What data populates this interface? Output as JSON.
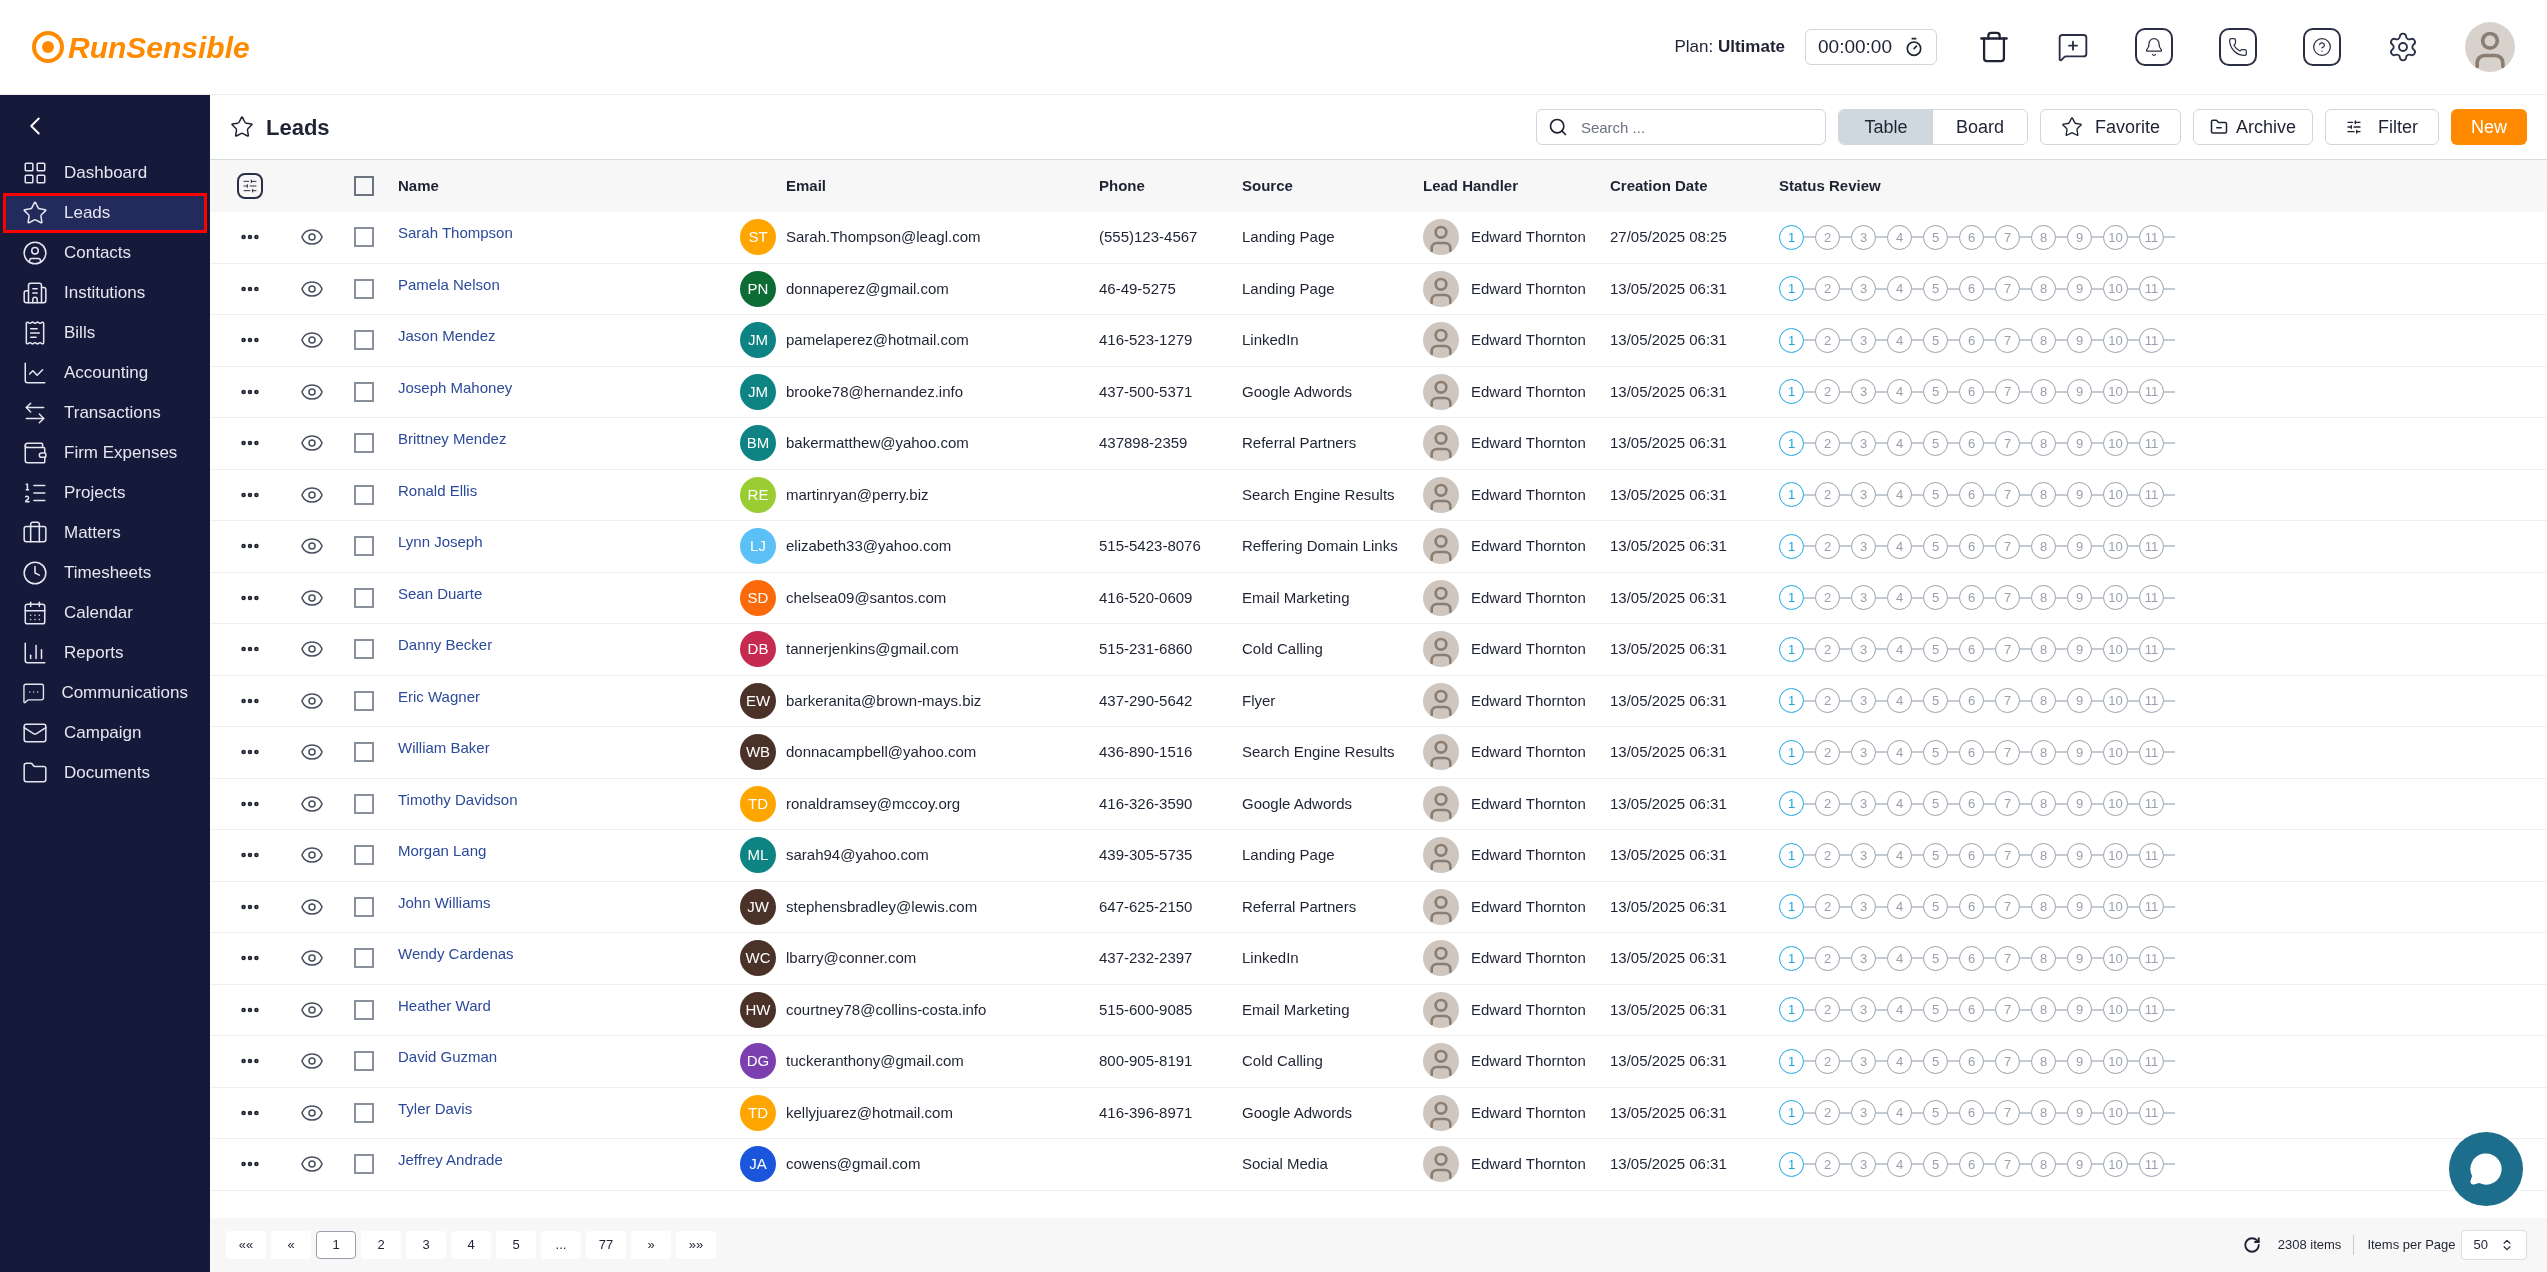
{
  "header": {
    "logo": "RunSensible",
    "plan": "Plan: **Ultimate**",
    "timer": "00:00:00"
  },
  "sidebar": {
    "items": [
      {
        "label": "Dashboard",
        "selected": false
      },
      {
        "label": "Leads",
        "selected": true
      },
      {
        "label": "Contacts",
        "selected": false
      },
      {
        "label": "Institutions",
        "selected": false
      },
      {
        "label": "Bills",
        "selected": false
      },
      {
        "label": "Accounting",
        "selected": false
      },
      {
        "label": "Transactions",
        "selected": false
      },
      {
        "label": "Firm Expenses",
        "selected": false
      },
      {
        "label": "Projects",
        "selected": false
      },
      {
        "label": "Matters",
        "selected": false
      },
      {
        "label": "Timesheets",
        "selected": false
      },
      {
        "label": "Calendar",
        "selected": false
      },
      {
        "label": "Reports",
        "selected": false
      },
      {
        "label": "Communications",
        "selected": false
      },
      {
        "label": "Campaign",
        "selected": false
      },
      {
        "label": "Documents",
        "selected": false
      }
    ]
  },
  "page": {
    "title": "Leads",
    "search": {
      "placeholder": "Search ..."
    },
    "views": [
      {
        "label": "Table",
        "selected": true
      },
      {
        "label": "Board",
        "selected": false
      }
    ],
    "buttons": {
      "favorite": "Favorite",
      "archive": "Archive",
      "filter": "Filter",
      "new": "New"
    }
  },
  "table": {
    "columns": [
      "Name",
      "Email",
      "Phone",
      "Source",
      "Lead Handler",
      "Creation Date",
      "Status Review"
    ],
    "select_all": {
      "checked": false
    },
    "rows": [
      {
        "checked": false,
        "name": "Sarah Thompson",
        "initials": "ST",
        "color": "#ffa500",
        "email": "Sarah.Thompson@leagl.com",
        "phone": "(555)123-4567",
        "source": "Landing Page",
        "handler": "Edward Thornton",
        "date": "27/05/2025 08:25",
        "status": [
          {
            "label": "1",
            "selected": true
          },
          {
            "label": "2",
            "selected": false
          },
          {
            "label": "3",
            "selected": false
          },
          {
            "label": "4",
            "selected": false
          },
          {
            "label": "5",
            "selected": false
          },
          {
            "label": "6",
            "selected": false
          },
          {
            "label": "7",
            "selected": false
          },
          {
            "label": "8",
            "selected": false
          },
          {
            "label": "9",
            "selected": false
          },
          {
            "label": "10",
            "selected": false
          },
          {
            "label": "11",
            "selected": false
          }
        ]
      },
      {
        "checked": false,
        "name": "Pamela Nelson",
        "initials": "PN",
        "color": "#0d6b34",
        "email": "donnaperez@gmail.com",
        "phone": "46-49-5275",
        "source": "Landing Page",
        "handler": "Edward Thornton",
        "date": "13/05/2025 06:31",
        "status": [
          {
            "label": "1",
            "selected": true
          },
          {
            "label": "2",
            "selected": false
          },
          {
            "label": "3",
            "selected": false
          },
          {
            "label": "4",
            "selected": false
          },
          {
            "label": "5",
            "selected": false
          },
          {
            "label": "6",
            "selected": false
          },
          {
            "label": "7",
            "selected": false
          },
          {
            "label": "8",
            "selected": false
          },
          {
            "label": "9",
            "selected": false
          },
          {
            "label": "10",
            "selected": false
          },
          {
            "label": "11",
            "selected": false
          }
        ]
      },
      {
        "checked": false,
        "name": "Jason Mendez",
        "initials": "JM",
        "color": "#0e8383",
        "email": "pamelaperez@hotmail.com",
        "phone": "416-523-1279",
        "source": "LinkedIn",
        "handler": "Edward Thornton",
        "date": "13/05/2025 06:31",
        "status": [
          {
            "label": "1",
            "selected": true
          },
          {
            "label": "2",
            "selected": false
          },
          {
            "label": "3",
            "selected": false
          },
          {
            "label": "4",
            "selected": false
          },
          {
            "label": "5",
            "selected": false
          },
          {
            "label": "6",
            "selected": false
          },
          {
            "label": "7",
            "selected": false
          },
          {
            "label": "8",
            "selected": false
          },
          {
            "label": "9",
            "selected": false
          },
          {
            "label": "10",
            "selected": false
          },
          {
            "label": "11",
            "selected": false
          }
        ]
      },
      {
        "checked": false,
        "name": "Joseph Mahoney",
        "initials": "JM",
        "color": "#0e8383",
        "email": "brooke78@hernandez.info",
        "phone": "437-500-5371",
        "source": "Google Adwords",
        "handler": "Edward Thornton",
        "date": "13/05/2025 06:31",
        "status": [
          {
            "label": "1",
            "selected": true
          },
          {
            "label": "2",
            "selected": false
          },
          {
            "label": "3",
            "selected": false
          },
          {
            "label": "4",
            "selected": false
          },
          {
            "label": "5",
            "selected": false
          },
          {
            "label": "6",
            "selected": false
          },
          {
            "label": "7",
            "selected": false
          },
          {
            "label": "8",
            "selected": false
          },
          {
            "label": "9",
            "selected": false
          },
          {
            "label": "10",
            "selected": false
          },
          {
            "label": "11",
            "selected": false
          }
        ]
      },
      {
        "checked": false,
        "name": "Brittney Mendez",
        "initials": "BM",
        "color": "#0e8383",
        "email": "bakermatthew@yahoo.com",
        "phone": "437898-2359",
        "source": "Referral Partners",
        "handler": "Edward Thornton",
        "date": "13/05/2025 06:31",
        "status": [
          {
            "label": "1",
            "selected": true
          },
          {
            "label": "2",
            "selected": false
          },
          {
            "label": "3",
            "selected": false
          },
          {
            "label": "4",
            "selected": false
          },
          {
            "label": "5",
            "selected": false
          },
          {
            "label": "6",
            "selected": false
          },
          {
            "label": "7",
            "selected": false
          },
          {
            "label": "8",
            "selected": false
          },
          {
            "label": "9",
            "selected": false
          },
          {
            "label": "10",
            "selected": false
          },
          {
            "label": "11",
            "selected": false
          }
        ]
      },
      {
        "checked": false,
        "name": "Ronald Ellis",
        "initials": "RE",
        "color": "#9acd32",
        "email": "martinryan@perry.biz",
        "source": "Search Engine Results",
        "handler": "Edward Thornton",
        "date": "13/05/2025 06:31",
        "status": [
          {
            "label": "1",
            "selected": true
          },
          {
            "label": "2",
            "selected": false
          },
          {
            "label": "3",
            "selected": false
          },
          {
            "label": "4",
            "selected": false
          },
          {
            "label": "5",
            "selected": false
          },
          {
            "label": "6",
            "selected": false
          },
          {
            "label": "7",
            "selected": false
          },
          {
            "label": "8",
            "selected": false
          },
          {
            "label": "9",
            "selected": false
          },
          {
            "label": "10",
            "selected": false
          },
          {
            "label": "11",
            "selected": false
          }
        ]
      },
      {
        "checked": false,
        "name": "Lynn Joseph",
        "initials": "LJ",
        "color": "#5bc0f5",
        "email": "elizabeth33@yahoo.com",
        "phone": "515-5423-8076",
        "source": "Reffering Domain Links",
        "handler": "Edward Thornton",
        "date": "13/05/2025 06:31",
        "status": [
          {
            "label": "1",
            "selected": true
          },
          {
            "label": "2",
            "selected": false
          },
          {
            "label": "3",
            "selected": false
          },
          {
            "label": "4",
            "selected": false
          },
          {
            "label": "5",
            "selected": false
          },
          {
            "label": "6",
            "selected": false
          },
          {
            "label": "7",
            "selected": false
          },
          {
            "label": "8",
            "selected": false
          },
          {
            "label": "9",
            "selected": false
          },
          {
            "label": "10",
            "selected": false
          },
          {
            "label": "11",
            "selected": false
          }
        ]
      },
      {
        "checked": false,
        "name": "Sean Duarte",
        "initials": "SD",
        "color": "#fa6a0a",
        "email": "chelsea09@santos.com",
        "phone": "416-520-0609",
        "source": "Email Marketing",
        "handler": "Edward Thornton",
        "date": "13/05/2025 06:31",
        "status": [
          {
            "label": "1",
            "selected": true
          },
          {
            "label": "2",
            "selected": false
          },
          {
            "label": "3",
            "selected": false
          },
          {
            "label": "4",
            "selected": false
          },
          {
            "label": "5",
            "selected": false
          },
          {
            "label": "6",
            "selected": false
          },
          {
            "label": "7",
            "selected": false
          },
          {
            "label": "8",
            "selected": false
          },
          {
            "label": "9",
            "selected": false
          },
          {
            "label": "10",
            "selected": false
          },
          {
            "label": "11",
            "selected": false
          }
        ]
      },
      {
        "checked": false,
        "name": "Danny Becker",
        "initials": "DB",
        "color": "#c62a50",
        "email": "tannerjenkins@gmail.com",
        "phone": "515-231-6860",
        "source": "Cold Calling",
        "handler": "Edward Thornton",
        "date": "13/05/2025 06:31",
        "status": [
          {
            "label": "1",
            "selected": true
          },
          {
            "label": "2",
            "selected": false
          },
          {
            "label": "3",
            "selected": false
          },
          {
            "label": "4",
            "selected": false
          },
          {
            "label": "5",
            "selected": false
          },
          {
            "label": "6",
            "selected": false
          },
          {
            "label": "7",
            "selected": false
          },
          {
            "label": "8",
            "selected": false
          },
          {
            "label": "9",
            "selected": false
          },
          {
            "label": "10",
            "selected": false
          },
          {
            "label": "11",
            "selected": false
          }
        ]
      },
      {
        "checked": false,
        "name": "Eric Wagner",
        "initials": "EW",
        "color": "#4a3228",
        "email": "barkeranita@brown-mays.biz",
        "phone": "437-290-5642",
        "source": "Flyer",
        "handler": "Edward Thornton",
        "date": "13/05/2025 06:31",
        "status": [
          {
            "label": "1",
            "selected": true
          },
          {
            "label": "2",
            "selected": false
          },
          {
            "label": "3",
            "selected": false
          },
          {
            "label": "4",
            "selected": false
          },
          {
            "label": "5",
            "selected": false
          },
          {
            "label": "6",
            "selected": false
          },
          {
            "label": "7",
            "selected": false
          },
          {
            "label": "8",
            "selected": false
          },
          {
            "label": "9",
            "selected": false
          },
          {
            "label": "10",
            "selected": false
          },
          {
            "label": "11",
            "selected": false
          }
        ]
      },
      {
        "checked": false,
        "name": "William Baker",
        "initials": "WB",
        "color": "#4a3228",
        "email": "donnacampbell@yahoo.com",
        "phone": "436-890-1516",
        "source": "Search Engine Results",
        "handler": "Edward Thornton",
        "date": "13/05/2025 06:31",
        "status": [
          {
            "label": "1",
            "selected": true
          },
          {
            "label": "2",
            "selected": false
          },
          {
            "label": "3",
            "selected": false
          },
          {
            "label": "4",
            "selected": false
          },
          {
            "label": "5",
            "selected": false
          },
          {
            "label": "6",
            "selected": false
          },
          {
            "label": "7",
            "selected": false
          },
          {
            "label": "8",
            "selected": false
          },
          {
            "label": "9",
            "selected": false
          },
          {
            "label": "10",
            "selected": false
          },
          {
            "label": "11",
            "selected": false
          }
        ]
      },
      {
        "checked": false,
        "name": "Timothy Davidson",
        "initials": "TD",
        "color": "#ffa500",
        "email": "ronaldramsey@mccoy.org",
        "phone": "416-326-3590",
        "source": "Google Adwords",
        "handler": "Edward Thornton",
        "date": "13/05/2025 06:31",
        "status": [
          {
            "label": "1",
            "selected": true
          },
          {
            "label": "2",
            "selected": false
          },
          {
            "label": "3",
            "selected": false
          },
          {
            "label": "4",
            "selected": false
          },
          {
            "label": "5",
            "selected": false
          },
          {
            "label": "6",
            "selected": false
          },
          {
            "label": "7",
            "selected": false
          },
          {
            "label": "8",
            "selected": false
          },
          {
            "label": "9",
            "selected": false
          },
          {
            "label": "10",
            "selected": false
          },
          {
            "label": "11",
            "selected": false
          }
        ]
      },
      {
        "checked": false,
        "name": "Morgan Lang",
        "initials": "ML",
        "color": "#0e8383",
        "email": "sarah94@yahoo.com",
        "phone": "439-305-5735",
        "source": "Landing Page",
        "handler": "Edward Thornton",
        "date": "13/05/2025 06:31",
        "status": [
          {
            "label": "1",
            "selected": true
          },
          {
            "label": "2",
            "selected": false
          },
          {
            "label": "3",
            "selected": false
          },
          {
            "label": "4",
            "selected": false
          },
          {
            "label": "5",
            "selected": false
          },
          {
            "label": "6",
            "selected": false
          },
          {
            "label": "7",
            "selected": false
          },
          {
            "label": "8",
            "selected": false
          },
          {
            "label": "9",
            "selected": false
          },
          {
            "label": "10",
            "selected": false
          },
          {
            "label": "11",
            "selected": false
          }
        ]
      },
      {
        "checked": false,
        "name": "John Williams",
        "initials": "JW",
        "color": "#4a3228",
        "email": "stephensbradley@lewis.com",
        "phone": "647-625-2150",
        "source": "Referral Partners",
        "handler": "Edward Thornton",
        "date": "13/05/2025 06:31",
        "status": [
          {
            "label": "1",
            "selected": true
          },
          {
            "label": "2",
            "selected": false
          },
          {
            "label": "3",
            "selected": false
          },
          {
            "label": "4",
            "selected": false
          },
          {
            "label": "5",
            "selected": false
          },
          {
            "label": "6",
            "selected": false
          },
          {
            "label": "7",
            "selected": false
          },
          {
            "label": "8",
            "selected": false
          },
          {
            "label": "9",
            "selected": false
          },
          {
            "label": "10",
            "selected": false
          },
          {
            "label": "11",
            "selected": false
          }
        ]
      },
      {
        "checked": false,
        "name": "Wendy Cardenas",
        "initials": "WC",
        "color": "#4a3228",
        "email": "lbarry@conner.com",
        "phone": "437-232-2397",
        "source": "LinkedIn",
        "handler": "Edward Thornton",
        "date": "13/05/2025 06:31",
        "status": [
          {
            "label": "1",
            "selected": true
          },
          {
            "label": "2",
            "selected": false
          },
          {
            "label": "3",
            "selected": false
          },
          {
            "label": "4",
            "selected": false
          },
          {
            "label": "5",
            "selected": false
          },
          {
            "label": "6",
            "selected": false
          },
          {
            "label": "7",
            "selected": false
          },
          {
            "label": "8",
            "selected": false
          },
          {
            "label": "9",
            "selected": false
          },
          {
            "label": "10",
            "selected": false
          },
          {
            "label": "11",
            "selected": false
          }
        ]
      },
      {
        "checked": false,
        "name": "Heather Ward",
        "initials": "HW",
        "color": "#4a3228",
        "email": "courtney78@collins-costa.info",
        "phone": "515-600-9085",
        "source": "Email Marketing",
        "handler": "Edward Thornton",
        "date": "13/05/2025 06:31",
        "status": [
          {
            "label": "1",
            "selected": true
          },
          {
            "label": "2",
            "selected": false
          },
          {
            "label": "3",
            "selected": false
          },
          {
            "label": "4",
            "selected": false
          },
          {
            "label": "5",
            "selected": false
          },
          {
            "label": "6",
            "selected": false
          },
          {
            "label": "7",
            "selected": false
          },
          {
            "label": "8",
            "selected": false
          },
          {
            "label": "9",
            "selected": false
          },
          {
            "label": "10",
            "selected": false
          },
          {
            "label": "11",
            "selected": false
          }
        ]
      },
      {
        "checked": false,
        "name": "David Guzman",
        "initials": "DG",
        "color": "#7b3fb0",
        "email": "tuckeranthony@gmail.com",
        "phone": "800-905-8191",
        "source": "Cold Calling",
        "handler": "Edward Thornton",
        "date": "13/05/2025 06:31",
        "status": [
          {
            "label": "1",
            "selected": true
          },
          {
            "label": "2",
            "selected": false
          },
          {
            "label": "3",
            "selected": false
          },
          {
            "label": "4",
            "selected": false
          },
          {
            "label": "5",
            "selected": false
          },
          {
            "label": "6",
            "selected": false
          },
          {
            "label": "7",
            "selected": false
          },
          {
            "label": "8",
            "selected": false
          },
          {
            "label": "9",
            "selected": false
          },
          {
            "label": "10",
            "selected": false
          },
          {
            "label": "11",
            "selected": false
          }
        ]
      },
      {
        "checked": false,
        "name": "Tyler Davis",
        "initials": "TD",
        "color": "#ffa500",
        "email": "kellyjuarez@hotmail.com",
        "phone": "416-396-8971",
        "source": "Google Adwords",
        "handler": "Edward Thornton",
        "date": "13/05/2025 06:31",
        "status": [
          {
            "label": "1",
            "selected": true
          },
          {
            "label": "2",
            "selected": false
          },
          {
            "label": "3",
            "selected": false
          },
          {
            "label": "4",
            "selected": false
          },
          {
            "label": "5",
            "selected": false
          },
          {
            "label": "6",
            "selected": false
          },
          {
            "label": "7",
            "selected": false
          },
          {
            "label": "8",
            "selected": false
          },
          {
            "label": "9",
            "selected": false
          },
          {
            "label": "10",
            "selected": false
          },
          {
            "label": "11",
            "selected": false
          }
        ]
      },
      {
        "checked": false,
        "name": "Jeffrey Andrade",
        "initials": "JA",
        "color": "#1a56db",
        "email": "cowens@gmail.com",
        "source": "Social Media",
        "handler": "Edward Thornton",
        "date": "13/05/2025 06:31",
        "status": [
          {
            "label": "1",
            "selected": true
          },
          {
            "label": "2",
            "selected": false
          },
          {
            "label": "3",
            "selected": false
          },
          {
            "label": "4",
            "selected": false
          },
          {
            "label": "5",
            "selected": false
          },
          {
            "label": "6",
            "selected": false
          },
          {
            "label": "7",
            "selected": false
          },
          {
            "label": "8",
            "selected": false
          },
          {
            "label": "9",
            "selected": false
          },
          {
            "label": "10",
            "selected": false
          },
          {
            "label": "11",
            "selected": false
          }
        ]
      }
    ]
  },
  "pagination": {
    "pages": [
      {
        "label": "««",
        "selected": false
      },
      {
        "label": "«",
        "selected": false
      },
      {
        "label": "1",
        "selected": true
      },
      {
        "label": "2",
        "selected": false
      },
      {
        "label": "3",
        "selected": false
      },
      {
        "label": "4",
        "selected": false
      },
      {
        "label": "5",
        "selected": false
      },
      {
        "label": "...",
        "selected": false
      },
      {
        "label": "77",
        "selected": false
      },
      {
        "label": "»",
        "selected": false
      },
      {
        "label": "»»",
        "selected": false
      }
    ],
    "total": "2308 items",
    "per_page_label": "Items per Page",
    "per_page": "50"
  }
}
